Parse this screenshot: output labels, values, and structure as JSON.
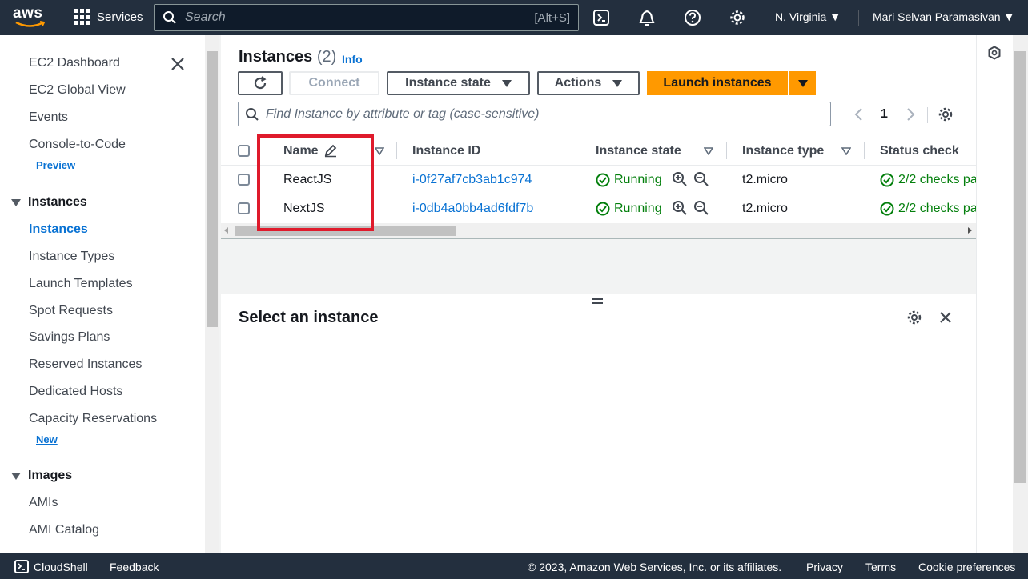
{
  "topnav": {
    "logo": "aws",
    "services": "Services",
    "search_placeholder": "Search",
    "search_shortcut": "[Alt+S]",
    "region": "N. Virginia",
    "user": "Mari Selvan Paramasivan"
  },
  "sidebar": {
    "items": [
      {
        "label": "EC2 Dashboard"
      },
      {
        "label": "EC2 Global View"
      },
      {
        "label": "Events"
      },
      {
        "label": "Console-to-Code",
        "badge": "Preview"
      }
    ],
    "group_instances": "Instances",
    "instances_items": [
      {
        "label": "Instances",
        "active": true
      },
      {
        "label": "Instance Types"
      },
      {
        "label": "Launch Templates"
      },
      {
        "label": "Spot Requests"
      },
      {
        "label": "Savings Plans"
      },
      {
        "label": "Reserved Instances"
      },
      {
        "label": "Dedicated Hosts"
      },
      {
        "label": "Capacity Reservations",
        "badge": "New"
      }
    ],
    "group_images": "Images",
    "images_items": [
      {
        "label": "AMIs"
      },
      {
        "label": "AMI Catalog"
      }
    ]
  },
  "main": {
    "title": "Instances",
    "count": "(2)",
    "info": "Info",
    "buttons": {
      "connect": "Connect",
      "instance_state": "Instance state",
      "actions": "Actions",
      "launch": "Launch instances"
    },
    "filter_placeholder": "Find Instance by attribute or tag (case-sensitive)",
    "page": "1",
    "columns": [
      "Name",
      "Instance ID",
      "Instance state",
      "Instance type",
      "Status check"
    ],
    "rows": [
      {
        "name": "ReactJS",
        "id": "i-0f27af7cb3ab1c974",
        "state": "Running",
        "type": "t2.micro",
        "status": "2/2 checks pa"
      },
      {
        "name": "NextJS",
        "id": "i-0db4a0bb4ad6fdf7b",
        "state": "Running",
        "type": "t2.micro",
        "status": "2/2 checks pa"
      }
    ],
    "details_title": "Select an instance"
  },
  "footer": {
    "cloudshell": "CloudShell",
    "feedback": "Feedback",
    "copyright": "© 2023, Amazon Web Services, Inc. or its affiliates.",
    "privacy": "Privacy",
    "terms": "Terms",
    "cookies": "Cookie preferences"
  },
  "colors": {
    "nav_bg": "#232f3e",
    "accent_orange": "#ff9900",
    "link_blue": "#0972d3",
    "success_green": "#037f0c",
    "highlight_red": "#df1a2b"
  }
}
